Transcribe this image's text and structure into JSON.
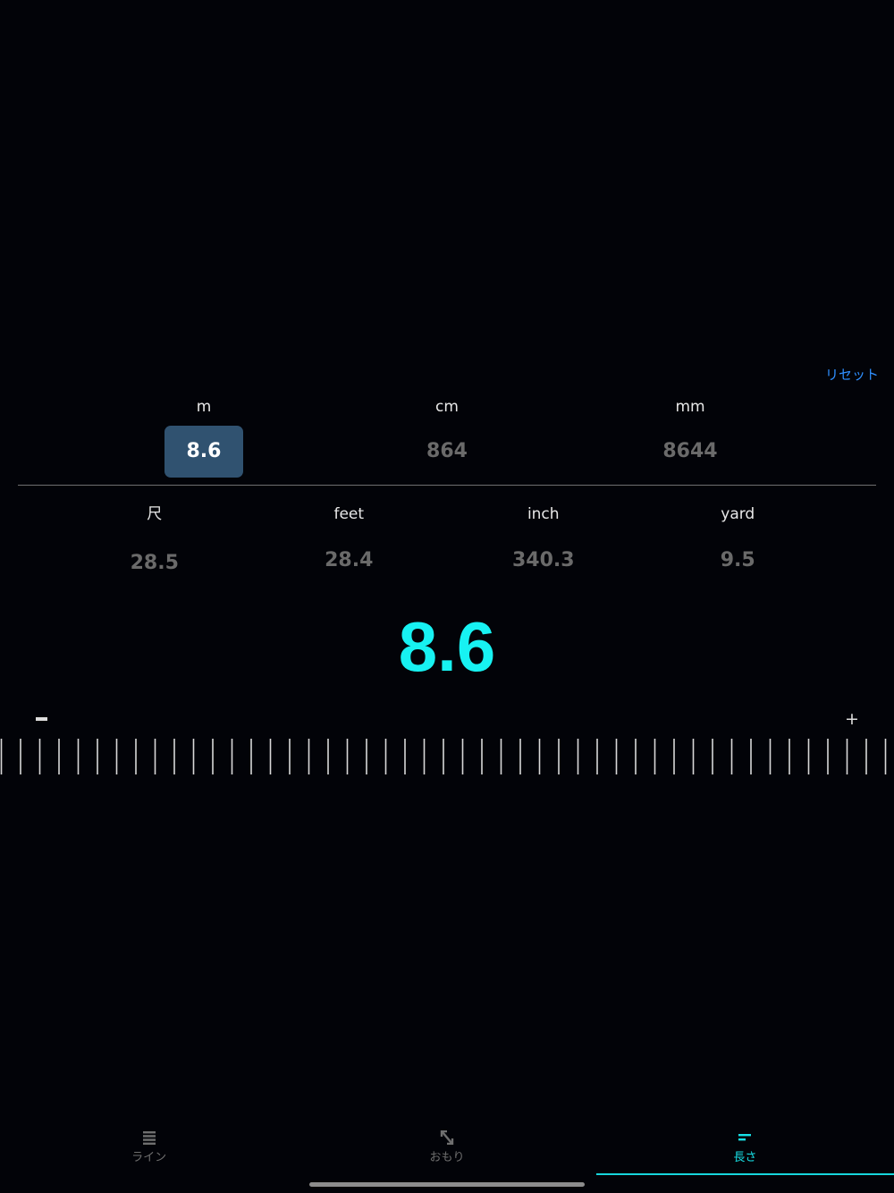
{
  "reset_label": "リセット",
  "metric_units": [
    {
      "label": "m",
      "value": "8.6",
      "selected": true
    },
    {
      "label": "cm",
      "value": "864",
      "selected": false
    },
    {
      "label": "mm",
      "value": "8644",
      "selected": false
    }
  ],
  "imperial_units": [
    {
      "label": "尺",
      "value": "28.5"
    },
    {
      "label": "feet",
      "value": "28.4"
    },
    {
      "label": "inch",
      "value": "340.3"
    },
    {
      "label": "yard",
      "value": "9.5"
    }
  ],
  "main_value": "8.6",
  "stepper": {
    "minus_icon": "minus-icon",
    "plus_label": "+"
  },
  "tabs": [
    {
      "label": "ライン",
      "icon": "list-icon",
      "active": false
    },
    {
      "label": "おもり",
      "icon": "resize-arrows-icon",
      "active": false
    },
    {
      "label": "長さ",
      "icon": "length-icon",
      "active": true
    }
  ],
  "colors": {
    "background": "#020308",
    "accent": "#17f2f2",
    "selected_bg": "#305270",
    "link": "#2f8fff",
    "inactive_value": "#6a6a6a"
  }
}
